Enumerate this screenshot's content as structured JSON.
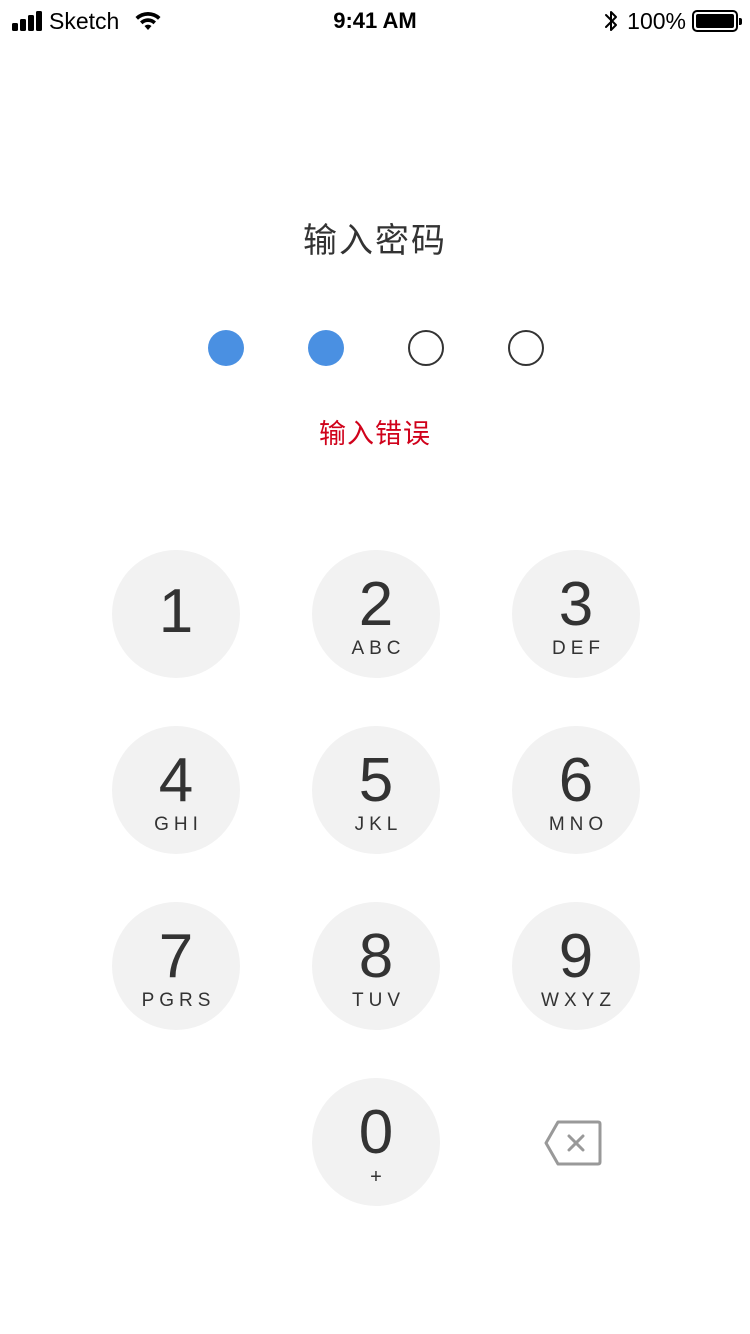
{
  "status_bar": {
    "carrier": "Sketch",
    "time": "9:41 AM",
    "battery": "100%",
    "signal_icon": "signal-bars-icon",
    "wifi_icon": "wifi-icon",
    "bluetooth_icon": "bluetooth-icon",
    "battery_icon": "battery-icon",
    "battery_level": 1.0
  },
  "title": "输入密码",
  "passcode": {
    "length": 4,
    "entered": 2,
    "filled_color": "#4a90e2",
    "empty_border_color": "#333333"
  },
  "error_message": "输入错误",
  "error_color": "#d0021b",
  "keypad": {
    "keys": [
      {
        "digit": "1",
        "letters": ""
      },
      {
        "digit": "2",
        "letters": "ABC"
      },
      {
        "digit": "3",
        "letters": "DEF"
      },
      {
        "digit": "4",
        "letters": "GHI"
      },
      {
        "digit": "5",
        "letters": "JKL"
      },
      {
        "digit": "6",
        "letters": "MNO"
      },
      {
        "digit": "7",
        "letters": "PGRS"
      },
      {
        "digit": "8",
        "letters": "TUV"
      },
      {
        "digit": "9",
        "letters": "WXYZ"
      },
      {
        "digit": "0",
        "letters": "+"
      }
    ],
    "key_background": "#f2f2f2",
    "delete_icon": "backspace-icon"
  }
}
